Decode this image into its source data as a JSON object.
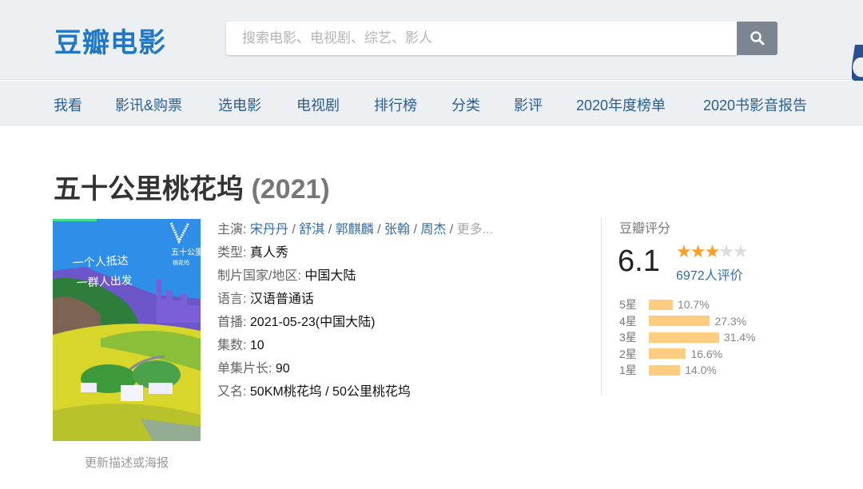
{
  "header": {
    "logo": "豆瓣电影",
    "search_placeholder": "搜索电影、电视剧、综艺、影人",
    "search_icon": "search-icon"
  },
  "nav": [
    "我看",
    "影讯&购票",
    "选电影",
    "电视剧",
    "排行榜",
    "分类",
    "影评",
    "2020年度榜单",
    "2020书影音报告"
  ],
  "title": {
    "name": "五十公里桃花坞",
    "year": "(2021)"
  },
  "poster": {
    "title_text": "五十公里桃花坞",
    "slogan": "一个人抵达 一群人出发",
    "update_link": "更新描述或海报"
  },
  "info": {
    "cast_label": "主演:",
    "cast": [
      "宋丹丹",
      "舒淇",
      "郭麒麟",
      "张翰",
      "周杰"
    ],
    "cast_more": "更多...",
    "fields": [
      {
        "label": "类型:",
        "value": "真人秀"
      },
      {
        "label": "制片国家/地区:",
        "value": "中国大陆"
      },
      {
        "label": "语言:",
        "value": "汉语普通话"
      },
      {
        "label": "首播:",
        "value": "2021-05-23(中国大陆)"
      },
      {
        "label": "集数:",
        "value": "10"
      },
      {
        "label": "单集片长:",
        "value": "90"
      },
      {
        "label": "又名:",
        "value": "50KM桃花坞 / 50公里桃花坞"
      }
    ]
  },
  "rating": {
    "label": "豆瓣评分",
    "score": "6.1",
    "stars": 3,
    "max_stars": 5,
    "count": "6972人评价",
    "star_color": "#ff9d2b",
    "breakdown": [
      {
        "label": "5星",
        "percent": 10.7,
        "text": "10.7%"
      },
      {
        "label": "4星",
        "percent": 27.3,
        "text": "27.3%"
      },
      {
        "label": "3星",
        "percent": 31.4,
        "text": "31.4%"
      },
      {
        "label": "2星",
        "percent": 16.6,
        "text": "16.6%"
      },
      {
        "label": "1星",
        "percent": 14.0,
        "text": "14.0%"
      }
    ]
  }
}
